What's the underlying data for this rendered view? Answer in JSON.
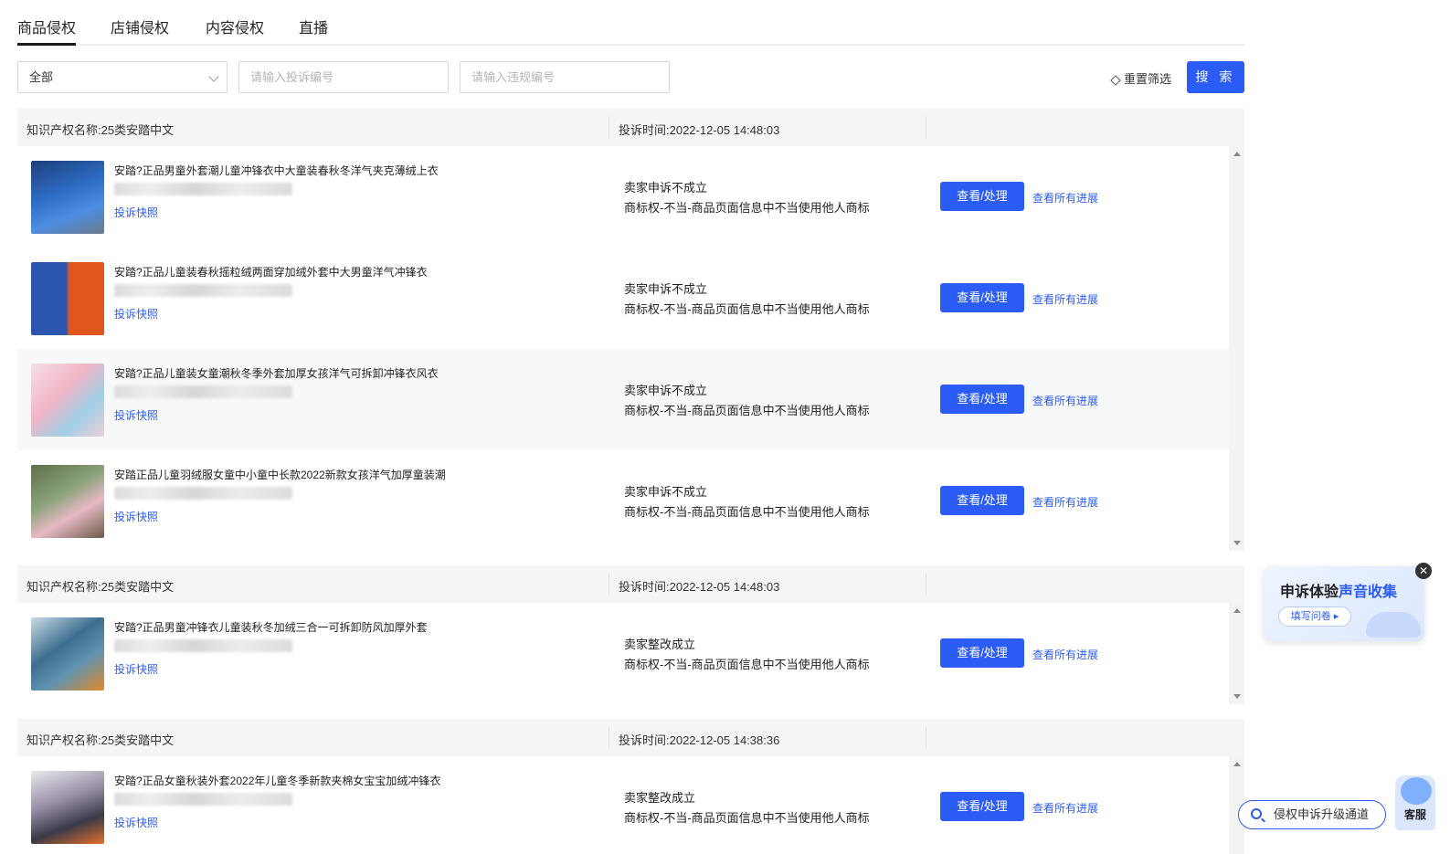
{
  "tabs": [
    "商品侵权",
    "店铺侵权",
    "内容侵权",
    "直播"
  ],
  "filters": {
    "status_select": "全部",
    "complaint_no_placeholder": "请输入投诉编号",
    "violation_no_placeholder": "请输入违规编号",
    "reset_label": "重置筛选",
    "search_label": "搜 索"
  },
  "groups": [
    {
      "ip_name": "知识产权名称:25类安踏中文",
      "time": "投诉时间:2022-12-05 14:48:03",
      "rows": [
        {
          "title": "安踏?正品男童外套潮儿童冲锋衣中大童装春秋冬洋气夹克薄绒上衣",
          "snapshot": "投诉快照",
          "status": "卖家申诉不成立",
          "reason": "商标权-不当-商品页面信息中不当使用他人商标",
          "view": "查看/处理",
          "progress": "查看所有进展",
          "thumb_color": "#2f6fc9"
        },
        {
          "title": "安踏?正品儿童装春秋摇粒绒两面穿加绒外套中大男童洋气冲锋衣",
          "snapshot": "投诉快照",
          "status": "卖家申诉不成立",
          "reason": "商标权-不当-商品页面信息中不当使用他人商标",
          "view": "查看/处理",
          "progress": "查看所有进展",
          "thumb_color": "#2c5aa8"
        },
        {
          "title": "安踏?正品儿童装女童潮秋冬季外套加厚女孩洋气可拆卸冲锋衣风衣",
          "snapshot": "投诉快照",
          "status": "卖家申诉不成立",
          "reason": "商标权-不当-商品页面信息中不当使用他人商标",
          "view": "查看/处理",
          "progress": "查看所有进展",
          "thumb_color": "#f2b6c6"
        },
        {
          "title": "安踏正品儿童羽绒服女童中小童中长款2022新款女孩洋气加厚童装潮",
          "snapshot": "投诉快照",
          "status": "卖家申诉不成立",
          "reason": "商标权-不当-商品页面信息中不当使用他人商标",
          "view": "查看/处理",
          "progress": "查看所有进展",
          "thumb_color": "#8aa27a"
        }
      ]
    },
    {
      "ip_name": "知识产权名称:25类安踏中文",
      "time": "投诉时间:2022-12-05 14:48:03",
      "rows": [
        {
          "title": "安踏?正品男童冲锋衣儿童装秋冬加绒三合一可拆卸防风加厚外套",
          "snapshot": "投诉快照",
          "status": "卖家整改成立",
          "reason": "商标权-不当-商品页面信息中不当使用他人商标",
          "view": "查看/处理",
          "progress": "查看所有进展",
          "thumb_color": "#3d6e8f"
        }
      ]
    },
    {
      "ip_name": "知识产权名称:25类安踏中文",
      "time": "投诉时间:2022-12-05 14:38:36",
      "rows": [
        {
          "title": "安踏?正品女童秋装外套2022年儿童冬季新款夹棉女宝宝加绒冲锋衣",
          "snapshot": "投诉快照",
          "status": "卖家整改成立",
          "reason": "商标权-不当-商品页面信息中不当使用他人商标",
          "view": "查看/处理",
          "progress": "查看所有进展",
          "thumb_color": "#9a8fa8"
        }
      ]
    }
  ],
  "survey": {
    "title_a": "申诉体验",
    "title_b": "声音收集",
    "button": "填写问卷 ▸"
  },
  "upgrade_label": "侵权申诉升级通道",
  "kefu_label": "客服"
}
